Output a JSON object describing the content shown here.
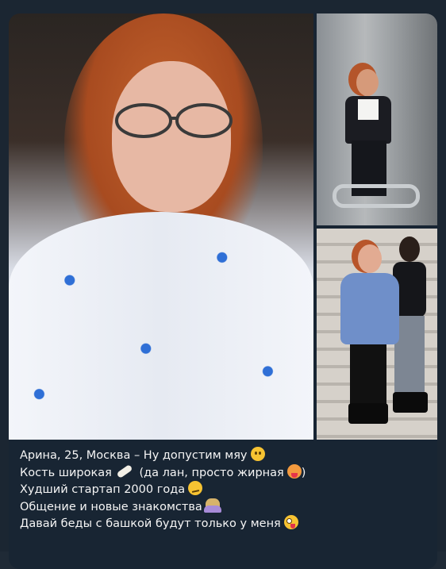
{
  "message": {
    "photos": [
      {
        "alt": "main-photo"
      },
      {
        "alt": "elevator-photo"
      },
      {
        "alt": "stairs-photo"
      }
    ],
    "caption_lines": [
      {
        "text": "Арина, 25, Москва – Ну допустим мяу",
        "emoji": "slightly-smiling-face"
      },
      {
        "text_before": "Кость широкая",
        "emoji": "bone",
        "text_after": "(да лан, просто жирная",
        "emoji_after": "nauseated-face",
        "text_end": ")"
      },
      {
        "text": "Худший стартап 2000 года",
        "emoji": "smirking-face"
      },
      {
        "text": "Общение и новые знакомства",
        "emoji": "person-raising-hand"
      },
      {
        "text": "Давай беды с башкой будут только у меня",
        "emoji": "zany-face"
      }
    ]
  }
}
